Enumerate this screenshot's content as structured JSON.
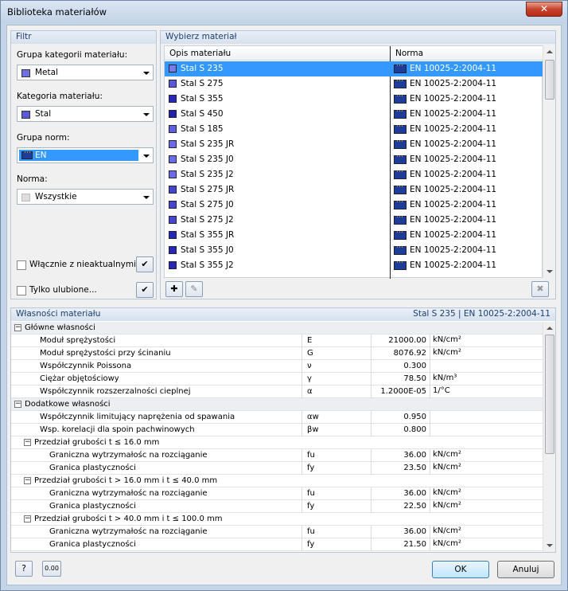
{
  "window": {
    "title": "Biblioteka materiałów",
    "close": "✕"
  },
  "filter": {
    "title": "Filtr",
    "group_label": "Grupa kategorii materiału:",
    "group_value": "Metal",
    "category_label": "Kategoria materiału:",
    "category_value": "Stal",
    "norm_group_label": "Grupa norm:",
    "norm_group_value": "EN",
    "norm_label": "Norma:",
    "norm_value": "Wszystkie",
    "include_outdated": "Włącznie z nieaktualnymi...",
    "favorites_only": "Tylko ulubione..."
  },
  "select": {
    "title": "Wybierz materiał",
    "col_desc": "Opis materiału",
    "col_norm": "Norma",
    "rows": [
      {
        "name": "Stal S 235",
        "norm": "EN 10025-2:2004-11",
        "color": "#7b7be8"
      },
      {
        "name": "Stal S 275",
        "norm": "EN 10025-2:2004-11",
        "color": "#5a5ad8"
      },
      {
        "name": "Stal S 355",
        "norm": "EN 10025-2:2004-11",
        "color": "#2828b8"
      },
      {
        "name": "Stal S 450",
        "norm": "EN 10025-2:2004-11",
        "color": "#2020a8"
      },
      {
        "name": "Stal S 185",
        "norm": "EN 10025-2:2004-11",
        "color": "#5f5fe0"
      },
      {
        "name": "Stal S 235 JR",
        "norm": "EN 10025-2:2004-11",
        "color": "#6a6ae6"
      },
      {
        "name": "Stal S 235 J0",
        "norm": "EN 10025-2:2004-11",
        "color": "#6a6ae6"
      },
      {
        "name": "Stal S 235 J2",
        "norm": "EN 10025-2:2004-11",
        "color": "#6a6ae6"
      },
      {
        "name": "Stal S 275 JR",
        "norm": "EN 10025-2:2004-11",
        "color": "#4545d0"
      },
      {
        "name": "Stal S 275 J0",
        "norm": "EN 10025-2:2004-11",
        "color": "#4545d0"
      },
      {
        "name": "Stal S 275 J2",
        "norm": "EN 10025-2:2004-11",
        "color": "#4545d0"
      },
      {
        "name": "Stal S 355 JR",
        "norm": "EN 10025-2:2004-11",
        "color": "#2626b6"
      },
      {
        "name": "Stal S 355 J0",
        "norm": "EN 10025-2:2004-11",
        "color": "#2626b6"
      },
      {
        "name": "Stal S 355 J2",
        "norm": "EN 10025-2:2004-11",
        "color": "#2626b6"
      }
    ]
  },
  "props": {
    "title": "Własności materiału",
    "selected": "Stal S 235  |  EN 10025-2:2004-11",
    "rows": [
      {
        "kind": "group",
        "level": 0,
        "name": "Główne własności",
        "sym": "",
        "val": "",
        "unit": ""
      },
      {
        "kind": "item",
        "level": 1,
        "name": "Moduł sprężystości",
        "sym": "E",
        "val": "21000.00",
        "unit": "kN/cm²"
      },
      {
        "kind": "item",
        "level": 1,
        "name": "Moduł sprężystości przy ścinaniu",
        "sym": "G",
        "val": "8076.92",
        "unit": "kN/cm²"
      },
      {
        "kind": "item",
        "level": 1,
        "name": "Współczynnik Poissona",
        "sym": "ν",
        "val": "0.300",
        "unit": ""
      },
      {
        "kind": "item",
        "level": 1,
        "name": "Ciężar objętościowy",
        "sym": "γ",
        "val": "78.50",
        "unit": "kN/m³"
      },
      {
        "kind": "item",
        "level": 1,
        "name": "Współczynnik rozszerzalności cieplnej",
        "sym": "α",
        "val": "1.2000E-05",
        "unit": "1/°C"
      },
      {
        "kind": "group",
        "level": 0,
        "name": "Dodatkowe własności",
        "sym": "",
        "val": "",
        "unit": ""
      },
      {
        "kind": "item",
        "level": 1,
        "name": "Współczynnik limitujący naprężenia od spawania",
        "sym": "αw",
        "val": "0.950",
        "unit": ""
      },
      {
        "kind": "item",
        "level": 1,
        "name": "Wsp. korelacji dla spoin pachwinowych",
        "sym": "βw",
        "val": "0.800",
        "unit": ""
      },
      {
        "kind": "subgroup",
        "level": 1,
        "name": "Przedział grubości t ≤ 16.0 mm",
        "sym": "",
        "val": "",
        "unit": ""
      },
      {
        "kind": "item",
        "level": 2,
        "name": "Graniczna wytrzymałośc na rozciąganie",
        "sym": "fu",
        "val": "36.00",
        "unit": "kN/cm²"
      },
      {
        "kind": "item",
        "level": 2,
        "name": "Granica plastyczności",
        "sym": "fy",
        "val": "23.50",
        "unit": "kN/cm²"
      },
      {
        "kind": "subgroup",
        "level": 1,
        "name": "Przedział grubości t > 16.0 mm i t ≤ 40.0 mm",
        "sym": "",
        "val": "",
        "unit": ""
      },
      {
        "kind": "item",
        "level": 2,
        "name": "Graniczna wytrzymałośc na rozciąganie",
        "sym": "fu",
        "val": "36.00",
        "unit": "kN/cm²"
      },
      {
        "kind": "item",
        "level": 2,
        "name": "Granica plastyczności",
        "sym": "fy",
        "val": "22.50",
        "unit": "kN/cm²"
      },
      {
        "kind": "subgroup",
        "level": 1,
        "name": "Przedział grubości t > 40.0 mm i t ≤ 100.0 mm",
        "sym": "",
        "val": "",
        "unit": ""
      },
      {
        "kind": "item",
        "level": 2,
        "name": "Graniczna wytrzymałośc na rozciąganie",
        "sym": "fu",
        "val": "36.00",
        "unit": "kN/cm²"
      },
      {
        "kind": "item",
        "level": 2,
        "name": "Granica plastyczności",
        "sym": "fy",
        "val": "21.50",
        "unit": "kN/cm²"
      }
    ]
  },
  "footer": {
    "ok": "OK",
    "cancel": "Anuluj",
    "units_icon": "0.00"
  },
  "colors": {
    "selection": "#3399ff",
    "metal": "#7070e0"
  }
}
